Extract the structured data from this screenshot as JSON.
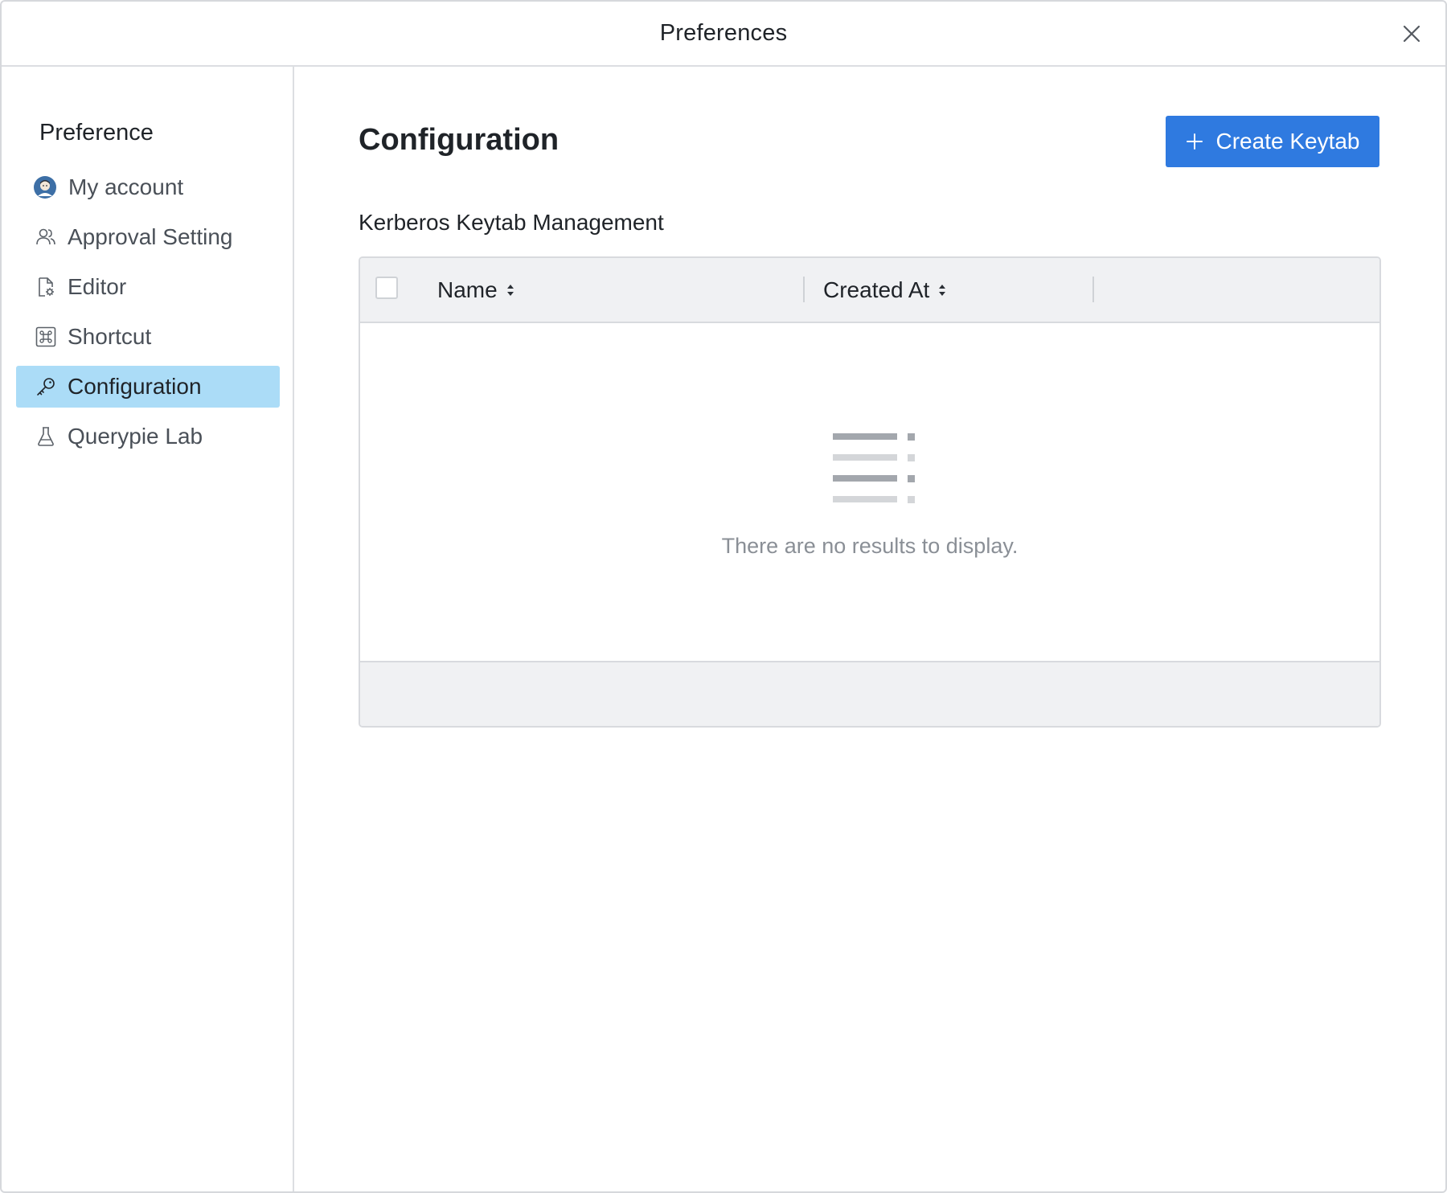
{
  "window": {
    "title": "Preferences"
  },
  "sidebar": {
    "heading": "Preference",
    "items": [
      {
        "label": "My account",
        "icon": "avatar-icon",
        "active": false
      },
      {
        "label": "Approval Setting",
        "icon": "users-icon",
        "active": false
      },
      {
        "label": "Editor",
        "icon": "file-gear-icon",
        "active": false
      },
      {
        "label": "Shortcut",
        "icon": "command-key-icon",
        "active": false
      },
      {
        "label": "Configuration",
        "icon": "key-icon",
        "active": true
      },
      {
        "label": "Querypie Lab",
        "icon": "flask-icon",
        "active": false
      }
    ]
  },
  "main": {
    "title": "Configuration",
    "create_button": "Create Keytab",
    "section_label": "Kerberos Keytab Management",
    "table": {
      "columns": [
        "Name",
        "Created At"
      ],
      "rows": [],
      "empty_message": "There are no results to display."
    }
  },
  "colors": {
    "accent": "#2f7ae0",
    "active_nav": "#abdcf7",
    "table_header_bg": "#f0f1f3"
  }
}
